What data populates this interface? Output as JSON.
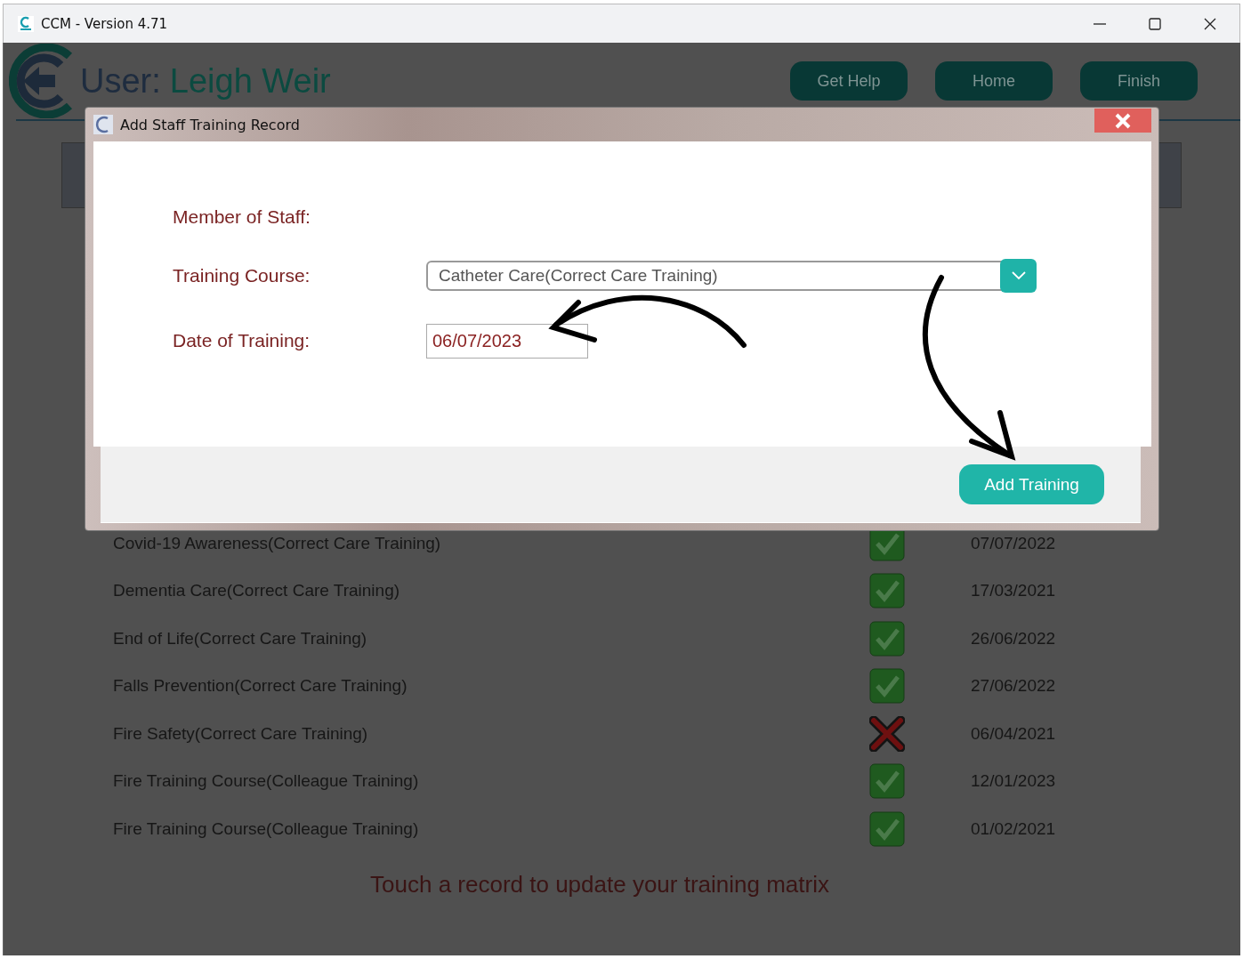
{
  "window": {
    "title": "CCM - Version 4.71"
  },
  "header": {
    "user_label": "User:",
    "user_name": "Leigh Weir",
    "buttons": [
      "Get Help",
      "Home",
      "Finish"
    ]
  },
  "records": [
    {
      "course": "Covid-19 Awareness(Correct Care Training)",
      "completed": true,
      "date": "07/07/2022"
    },
    {
      "course": "Dementia Care(Correct Care Training)",
      "completed": true,
      "date": "17/03/2021"
    },
    {
      "course": "End of Life(Correct Care Training)",
      "completed": true,
      "date": "26/06/2022"
    },
    {
      "course": "Falls Prevention(Correct Care Training)",
      "completed": true,
      "date": "27/06/2022"
    },
    {
      "course": "Fire Safety(Correct Care Training)",
      "completed": false,
      "date": "06/04/2021"
    },
    {
      "course": "Fire Training Course(Colleague Training)",
      "completed": true,
      "date": "12/01/2023"
    },
    {
      "course": "Fire Training Course(Colleague Training)",
      "completed": true,
      "date": "01/02/2021"
    }
  ],
  "footer_message": "Touch a record to update your training matrix",
  "dialog": {
    "title": "Add Staff Training Record",
    "fields": [
      {
        "kind": "text",
        "label": "Member of Staff:"
      },
      {
        "kind": "dropdown",
        "label": "Training Course:",
        "value": "Catheter Care(Correct Care Training)"
      },
      {
        "kind": "date",
        "label": "Date of Training:",
        "value": "06/07/2023"
      }
    ],
    "button": "Add Training"
  }
}
